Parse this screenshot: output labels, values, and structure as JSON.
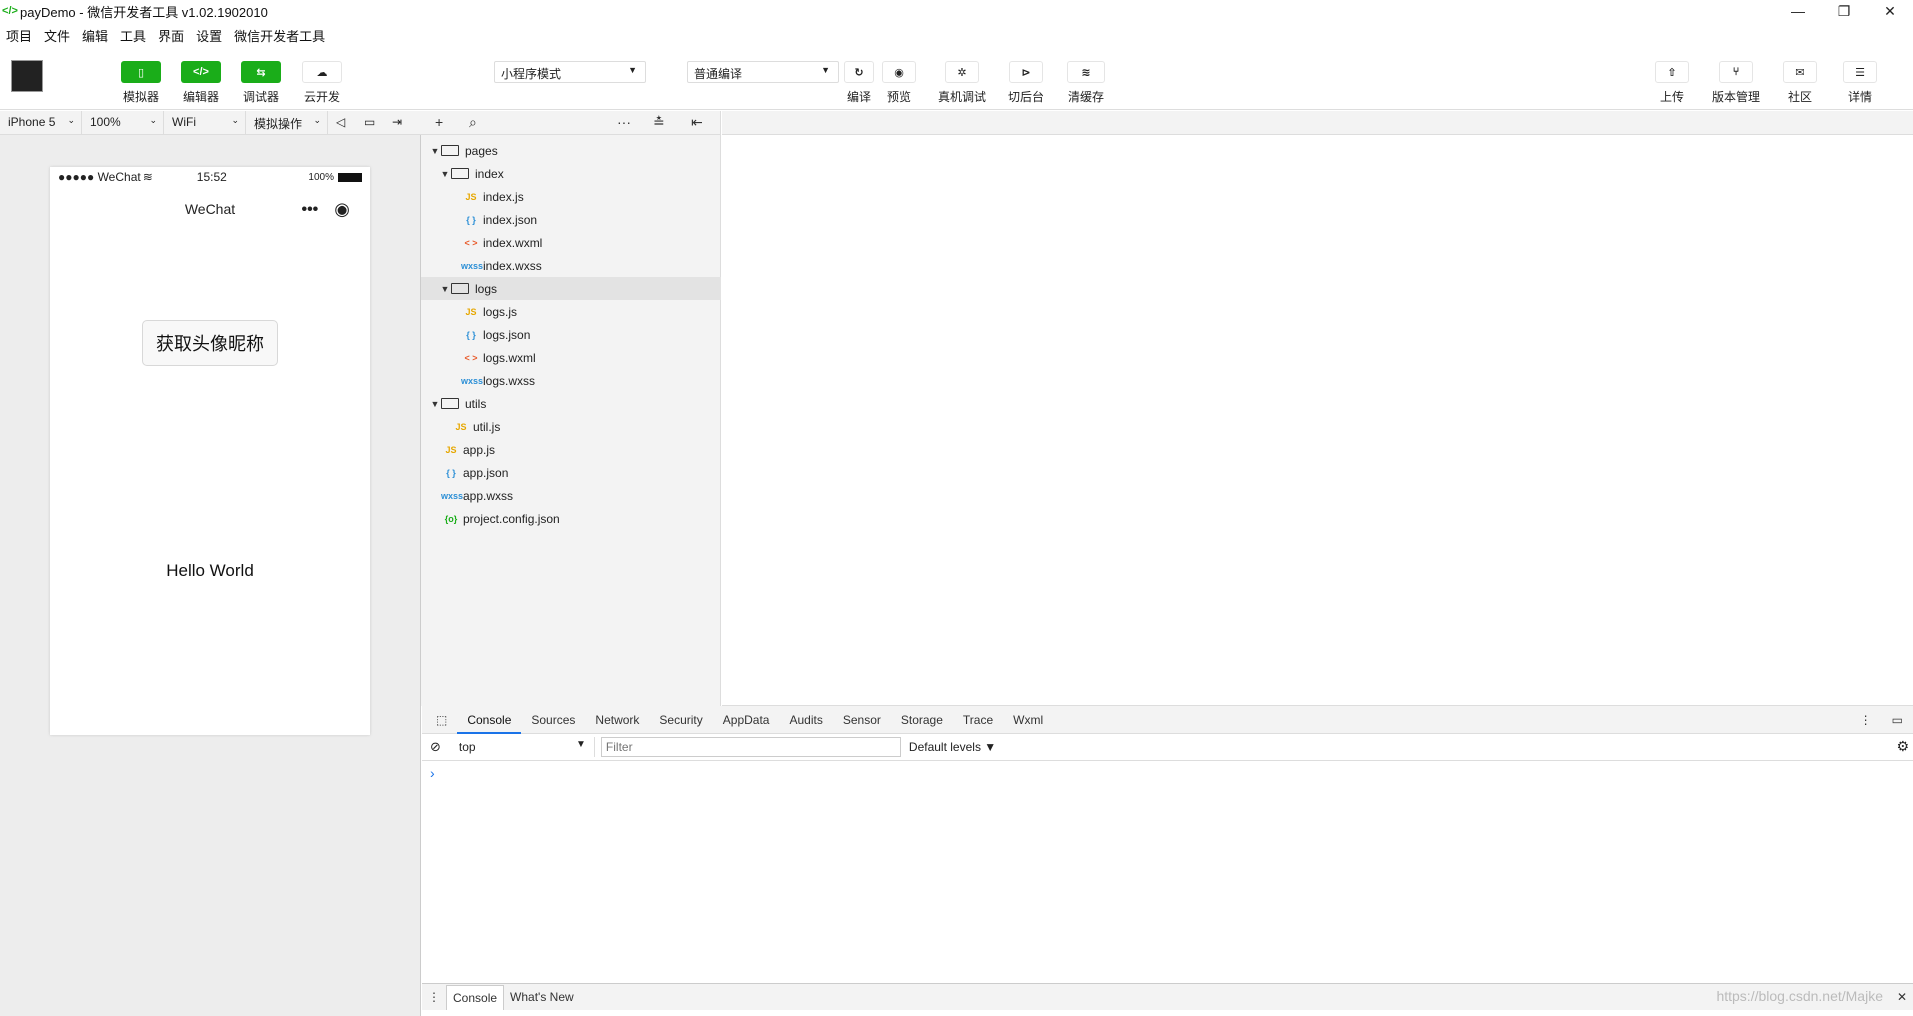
{
  "window": {
    "title": "payDemo - 微信开发者工具 v1.02.1902010",
    "minimize": "—",
    "restore": "❐",
    "close": "✕"
  },
  "menu": [
    "项目",
    "文件",
    "编辑",
    "工具",
    "界面",
    "设置",
    "微信开发者工具"
  ],
  "toolbar": {
    "left": [
      {
        "name": "simulator",
        "label": "模拟器",
        "icon": "▯"
      },
      {
        "name": "editor",
        "label": "编辑器",
        "icon": "</>"
      },
      {
        "name": "debugger",
        "label": "调试器",
        "icon": "⇆"
      },
      {
        "name": "cloud",
        "label": "云开发",
        "icon": "☁"
      }
    ],
    "mode_select": "小程序模式",
    "compile_select": "普通编译",
    "middle": [
      {
        "name": "compile",
        "label": "编译",
        "icon": "↻"
      },
      {
        "name": "preview",
        "label": "预览",
        "icon": "◉"
      },
      {
        "name": "remote-debug",
        "label": "真机调试",
        "icon": "✲"
      },
      {
        "name": "background",
        "label": "切后台",
        "icon": "⊳"
      },
      {
        "name": "clear-cache",
        "label": "清缓存",
        "icon": "≋"
      }
    ],
    "right": [
      {
        "name": "upload",
        "label": "上传",
        "icon": "⇧"
      },
      {
        "name": "version",
        "label": "版本管理",
        "icon": "⑂"
      },
      {
        "name": "community",
        "label": "社区",
        "icon": "✉"
      },
      {
        "name": "details",
        "label": "详情",
        "icon": "☰"
      }
    ]
  },
  "simbar": {
    "device": "iPhone 5",
    "zoom": "100%",
    "network": "WiFi",
    "ops": "模拟操作"
  },
  "phone": {
    "carrier": "●●●●● WeChat",
    "time": "15:52",
    "battery": "100%",
    "nav_title": "WeChat",
    "capsule_more": "•••",
    "capsule_close": "◉",
    "button_label": "获取头像昵称",
    "hello": "Hello World"
  },
  "tree": [
    {
      "label": "pages",
      "type": "folder",
      "depth": 0,
      "open": true
    },
    {
      "label": "index",
      "type": "folder",
      "depth": 1,
      "open": true
    },
    {
      "label": "index.js",
      "type": "js",
      "depth": 2
    },
    {
      "label": "index.json",
      "type": "json",
      "depth": 2
    },
    {
      "label": "index.wxml",
      "type": "wxml",
      "depth": 2
    },
    {
      "label": "index.wxss",
      "type": "wxss",
      "depth": 2
    },
    {
      "label": "logs",
      "type": "folder",
      "depth": 1,
      "open": true,
      "selected": true
    },
    {
      "label": "logs.js",
      "type": "js",
      "depth": 2
    },
    {
      "label": "logs.json",
      "type": "json",
      "depth": 2
    },
    {
      "label": "logs.wxml",
      "type": "wxml",
      "depth": 2
    },
    {
      "label": "logs.wxss",
      "type": "wxss",
      "depth": 2
    },
    {
      "label": "utils",
      "type": "folder",
      "depth": 0,
      "open": true
    },
    {
      "label": "util.js",
      "type": "js",
      "depth": 1
    },
    {
      "label": "app.js",
      "type": "js",
      "depth": 0
    },
    {
      "label": "app.json",
      "type": "json",
      "depth": 0
    },
    {
      "label": "app.wxss",
      "type": "wxss",
      "depth": 0
    },
    {
      "label": "project.config.json",
      "type": "config",
      "depth": 0
    }
  ],
  "fileicons": {
    "js": "JS",
    "json": "{ }",
    "wxml": "< >",
    "wxss": "wxss",
    "config": "{o}"
  },
  "fileiconcolors": {
    "js": "#e6a700",
    "json": "#2b8fd6",
    "wxml": "#e85a2a",
    "wxss": "#2b8fd6",
    "config": "#1aad19"
  },
  "devtools": {
    "tabs": [
      "Console",
      "Sources",
      "Network",
      "Security",
      "AppData",
      "Audits",
      "Sensor",
      "Storage",
      "Trace",
      "Wxml"
    ],
    "active_tab": "Console",
    "context": "top",
    "filter_placeholder": "Filter",
    "levels": "Default levels ▼",
    "prompt": "›"
  },
  "drawer": {
    "tabs": [
      "Console",
      "What's New"
    ]
  },
  "watermark": "https://blog.csdn.net/Majke"
}
